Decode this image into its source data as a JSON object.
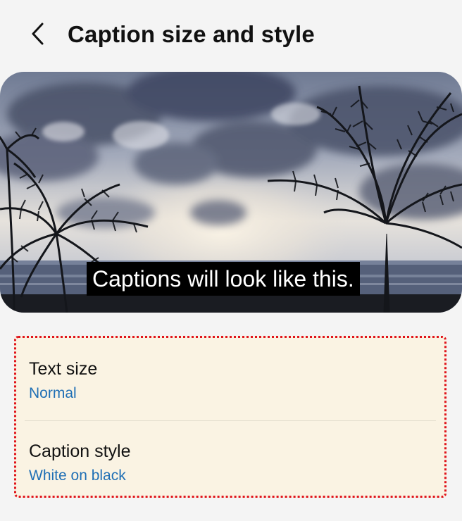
{
  "header": {
    "title": "Caption size and style",
    "back_icon": "chevron-left-icon"
  },
  "preview": {
    "caption_text": "Captions will look like this."
  },
  "settings": {
    "items": [
      {
        "label": "Text size",
        "value": "Normal"
      },
      {
        "label": "Caption style",
        "value": "White on black"
      }
    ]
  },
  "colors": {
    "background": "#f4f4f4",
    "card_background": "#faf3e3",
    "highlight_border": "#e0141c",
    "value_text": "#1f6fb5",
    "caption_background": "#000000",
    "caption_text": "#ffffff"
  }
}
